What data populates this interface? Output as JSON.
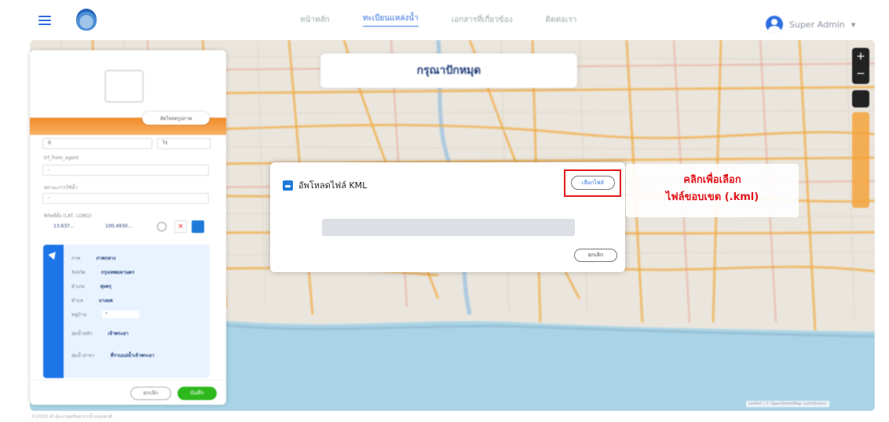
{
  "topbar": {
    "nav": [
      "หน้าหลัก",
      "ทะเบียนแหล่งน้ำ",
      "เอกสารที่เกี่ยวข้อง",
      "ติดต่อเรา"
    ],
    "active_index": 1,
    "user_name": "Super Admin",
    "user_caret": "▾"
  },
  "map_header": {
    "title": "กรุณาปักหมุด"
  },
  "map_controls": {
    "zoom_in": "+",
    "zoom_out": "−"
  },
  "side_panel": {
    "upload_image_label": "อัพโหลดรูปภาพ",
    "field1_value": "0",
    "field1_unit": "ไร่",
    "field2_label": "trf_from_agent",
    "field2_value": "-",
    "field3_label": "สถานะการใช้น้ำ",
    "field3_value": "-",
    "coords_label": "พิกัดที่ตั้ง (LAT, LONG)",
    "lat": "13.637...",
    "long": "100.4930...",
    "info": [
      {
        "k": "ภาค",
        "v": "ภาคกลาง"
      },
      {
        "k": "จังหวัด",
        "v": "กรุงเทพมหานคร"
      },
      {
        "k": "อำเภอ",
        "v": "ทุ่งครุ"
      },
      {
        "k": "ตำบล",
        "v": "บางมด"
      },
      {
        "k": "หมู่บ้าน",
        "v": "-"
      },
      {
        "k": "ลุ่มน้ำหลัก",
        "v": "เจ้าพระยา"
      },
      {
        "k": "ลุ่มน้ำสาขา",
        "v": "ที่ราบแม่น้ำเจ้าพระยา"
      }
    ],
    "cancel_label": "ยกเลิก",
    "save_label": "บันทึก"
  },
  "modal": {
    "title": "อัพโหลดไฟล์ KML",
    "choose_file_label": "เลือกไฟล์",
    "cancel_label": "ยกเลิก"
  },
  "callout": {
    "line1": "คลิกเพื่อเลือก",
    "line2": "ไฟล์ขอบเขต (.kml)"
  },
  "attribution": "Leaflet | © OpenStreetMap contributors",
  "footer": "©2020 สำนักงานทรัพยากรน้ำแห่งชาติ",
  "colors": {
    "accent": "#2f6fe0",
    "orange": "#f28a2a",
    "red": "#e0141a",
    "green": "#2db81c"
  }
}
